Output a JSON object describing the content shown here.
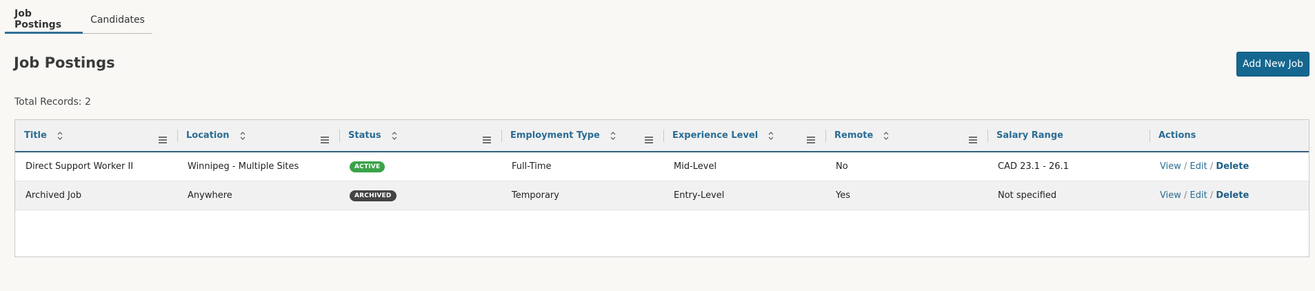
{
  "tabs": [
    {
      "label": "Job Postings",
      "active": true
    },
    {
      "label": "Candidates",
      "active": false
    }
  ],
  "page": {
    "title": "Job Postings",
    "add_button_label": "Add New Job",
    "total_records": "Total Records: 2"
  },
  "columns": [
    {
      "label": "Title",
      "sortable": true,
      "menu": true
    },
    {
      "label": "Location",
      "sortable": true,
      "menu": true
    },
    {
      "label": "Status",
      "sortable": true,
      "menu": true
    },
    {
      "label": "Employment Type",
      "sortable": true,
      "menu": true
    },
    {
      "label": "Experience Level",
      "sortable": true,
      "menu": true
    },
    {
      "label": "Remote",
      "sortable": true,
      "menu": true
    },
    {
      "label": "Salary Range",
      "sortable": false,
      "menu": false
    },
    {
      "label": "Actions",
      "sortable": false,
      "menu": false
    }
  ],
  "rows": [
    {
      "title": "Direct Support Worker II",
      "location": "Winnipeg - Multiple Sites",
      "status": "ACTIVE",
      "employment_type": "Full-Time",
      "experience_level": "Mid-Level",
      "remote": "No",
      "salary_range": "CAD 23.1 - 26.1"
    },
    {
      "title": "Archived Job",
      "location": "Anywhere",
      "status": "ARCHIVED",
      "employment_type": "Temporary",
      "experience_level": "Entry-Level",
      "remote": "Yes",
      "salary_range": "Not specified"
    }
  ],
  "actions": {
    "view": "View",
    "edit": "Edit",
    "delete": "Delete",
    "separator": "/"
  },
  "colors": {
    "accent": "#15678f",
    "header_text": "#2a6c94",
    "active_badge": "#3aa349",
    "archived_badge": "#444444"
  },
  "icons": {
    "sort": "sort-icon",
    "column_menu": "menu-icon"
  }
}
